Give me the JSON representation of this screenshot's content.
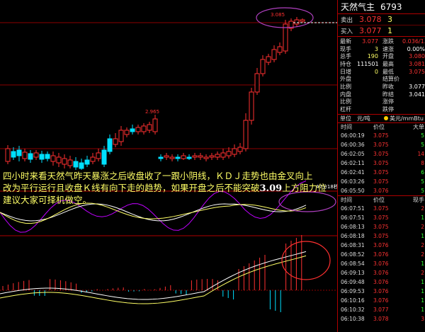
{
  "annotation": {
    "line1": "四小时来看天然气昨天暴涨之后收盘收了一跟小阴线，ＫＤＪ走势也由金叉向上",
    "line2_pre": "改为平行运行且收盘Ｋ线有向下走的趋势，如果开盘之后不能突破",
    "line2_bold": "3.09",
    "line2_post": "上方阻力位",
    "line3": "建议大家可择机做空。"
  },
  "chart_labels": {
    "high_price": "3.085",
    "mid_price": "2.965",
    "time_tag": "47分18秒"
  },
  "panel": {
    "title": "天然气主",
    "code": "6793",
    "sell": {
      "label": "卖出",
      "price": "3.078",
      "vol": "3"
    },
    "buy": {
      "label": "买入",
      "price": "3.077",
      "vol": "1"
    },
    "stats": [
      [
        "最新",
        "3.077",
        "涨跌",
        "0.036/1.18%"
      ],
      [
        "现手",
        "3",
        "速涨",
        "0.00%"
      ],
      [
        "总手",
        "190",
        "开盘",
        "3.080"
      ],
      [
        "持仓",
        "111501",
        "最高",
        "3.081"
      ],
      [
        "日增",
        "0",
        "最低",
        "3.075"
      ],
      [
        "外盘",
        "",
        "结算价",
        ""
      ],
      [
        "比例",
        "",
        "昨收",
        "3.077"
      ],
      [
        "内盘",
        "",
        "昨结",
        "3.041"
      ],
      [
        "比例",
        "",
        "涨停",
        ""
      ],
      [
        "杠杆",
        "",
        "跌停",
        ""
      ]
    ],
    "unit": {
      "label": "单位",
      "val": "元/吨",
      "ccy": "美元/mmBtu"
    },
    "ticks1_head": [
      "时间",
      "价位",
      "大单"
    ],
    "ticks1": [
      [
        "06:00:19",
        "3.075",
        "5"
      ],
      [
        "06:00:36",
        "3.075",
        "5"
      ],
      [
        "06:02:05",
        "3.075",
        "14"
      ],
      [
        "06:02:11",
        "3.075",
        "8"
      ],
      [
        "06:02:41",
        "3.075",
        "6"
      ],
      [
        "06:03:26",
        "3.075",
        "5"
      ],
      [
        "06:05:50",
        "3.076",
        "5"
      ]
    ],
    "ticks2_head": [
      "时间",
      "价位",
      "现手"
    ],
    "ticks2": [
      [
        "06:07:51",
        "3.075",
        "2"
      ],
      [
        "06:07:51",
        "3.075",
        "1"
      ],
      [
        "06:08:13",
        "3.075",
        "2"
      ],
      [
        "06:08:18",
        "3.075",
        "1"
      ],
      [
        "06:08:31",
        "3.076",
        "2"
      ],
      [
        "06:08:52",
        "3.076",
        "2"
      ],
      [
        "06:08:54",
        "3.076",
        "1"
      ],
      [
        "06:09:13",
        "3.076",
        "2"
      ],
      [
        "06:09:48",
        "3.076",
        "1"
      ],
      [
        "06:09:53",
        "3.076",
        "1"
      ],
      [
        "06:10:16",
        "3.076",
        "1"
      ],
      [
        "06:10:32",
        "3.077",
        "1"
      ],
      [
        "06:10:38",
        "3.078",
        "3"
      ]
    ]
  }
}
